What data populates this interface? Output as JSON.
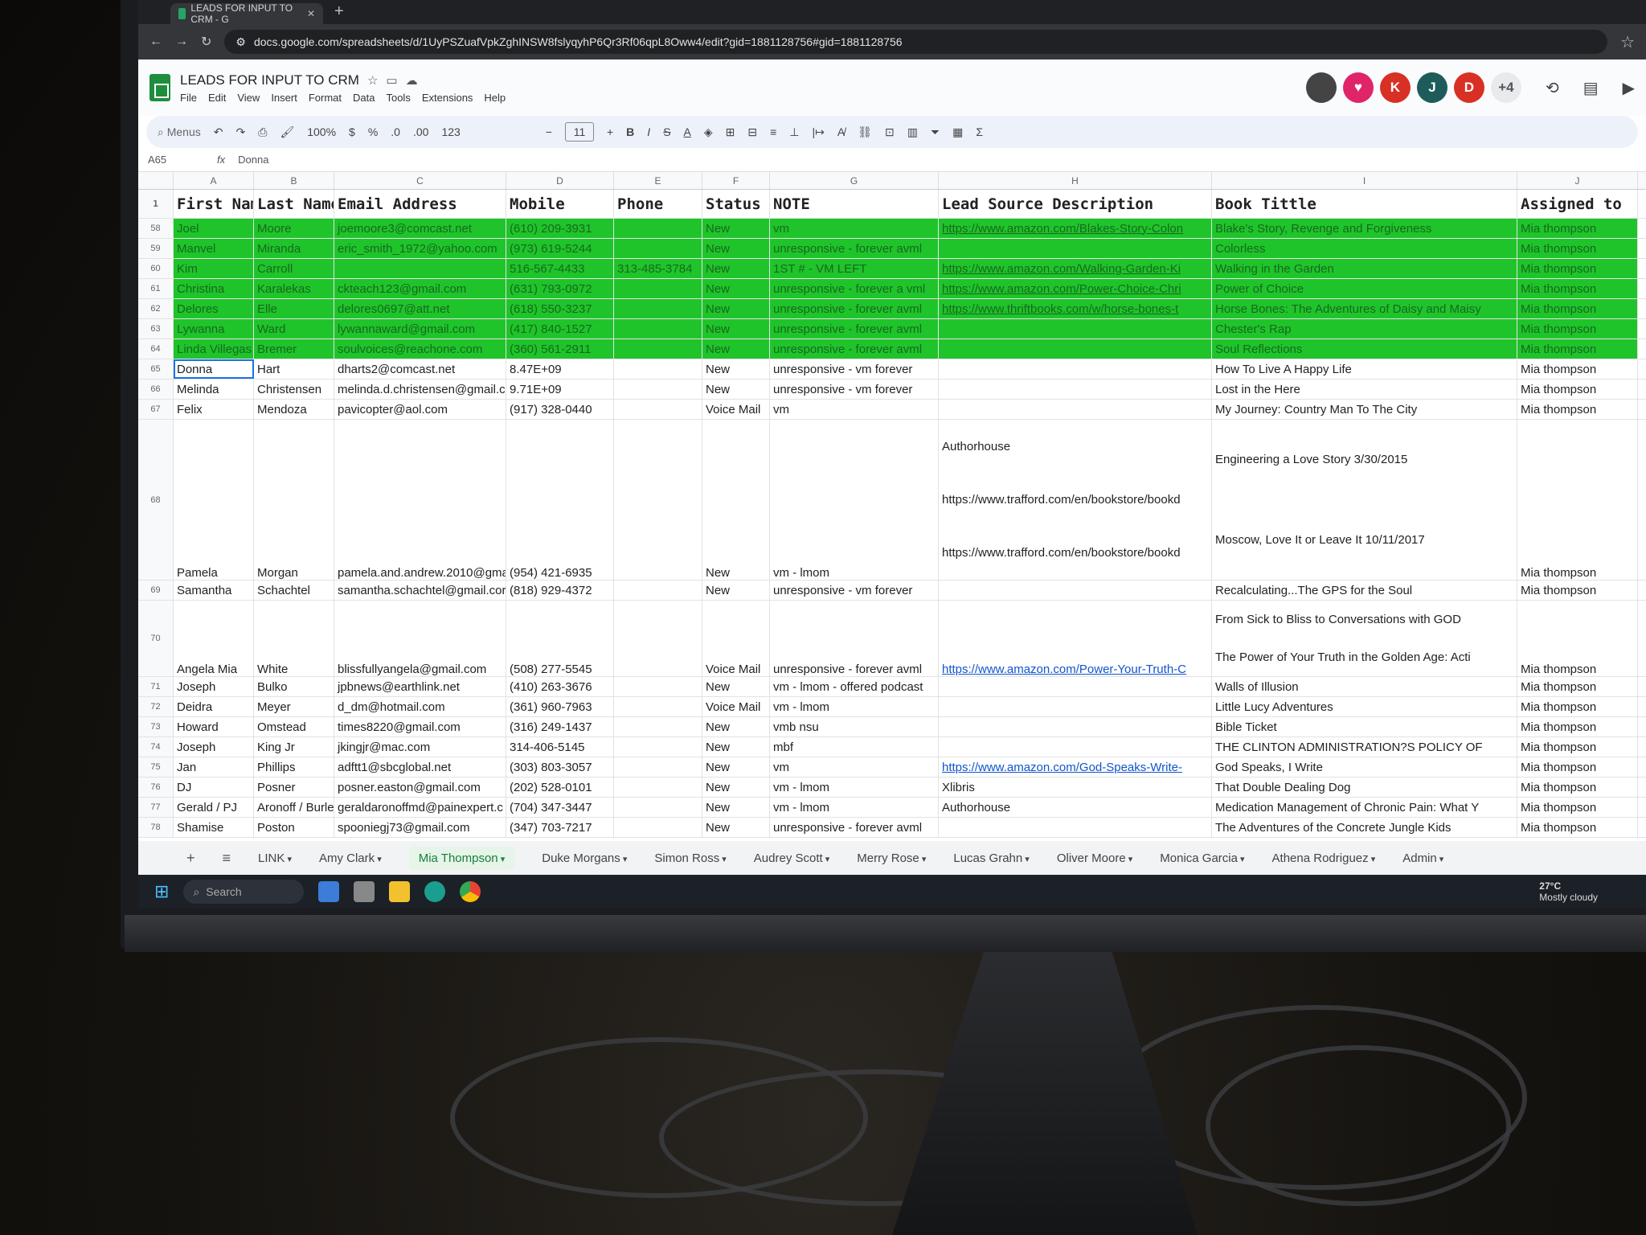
{
  "browser": {
    "tab_title": "LEADS FOR INPUT TO CRM - G",
    "new_tab": "+",
    "url": "docs.google.com/spreadsheets/d/1UyPSZuafVpkZghINSW8fslyqyhP6Qr3Rf06qpL8Oww4/edit?gid=1881128756#gid=1881128756"
  },
  "doc": {
    "title": "LEADS FOR INPUT TO CRM",
    "menu": [
      "File",
      "Edit",
      "View",
      "Insert",
      "Format",
      "Data",
      "Tools",
      "Extensions",
      "Help"
    ]
  },
  "collaborators": [
    {
      "label": "",
      "color": "#444444"
    },
    {
      "label": "♥",
      "color": "#e0246a"
    },
    {
      "label": "K",
      "color": "#d93025"
    },
    {
      "label": "J",
      "color": "#1e5c5c"
    },
    {
      "label": "D",
      "color": "#d93025"
    },
    {
      "label": "+4",
      "color": "#e8eaed"
    }
  ],
  "toolbar": {
    "search": "Menus",
    "zoom": "100%",
    "currency": "$",
    "percent": "%",
    "dec_less": ".0",
    "dec_more": ".00",
    "format": "123",
    "font_size": "11",
    "bold": "B",
    "italic": "I",
    "sum": "Σ"
  },
  "formula_bar": {
    "cell": "A65",
    "fx": "fx",
    "value": "Donna"
  },
  "columns": [
    "A",
    "B",
    "C",
    "D",
    "E",
    "F",
    "G",
    "H",
    "I",
    "J"
  ],
  "header_row": {
    "num": "1",
    "cells": [
      "First Nam",
      "Last Name",
      "Email Address",
      "Mobile",
      "Phone",
      "Status",
      "NOTE",
      "Lead Source Description",
      "Book Tittle",
      "Assigned to"
    ]
  },
  "rows": [
    {
      "num": "58",
      "green": true,
      "cells": [
        "Joel",
        "Moore",
        "joemoore3@comcast.net",
        "(610) 209-3931",
        "",
        "New",
        "vm",
        "https://www.amazon.com/Blakes-Story-Colon",
        "Blake's Story, Revenge and Forgiveness",
        "Mia thompson"
      ]
    },
    {
      "num": "59",
      "green": true,
      "cells": [
        "Manvel",
        "Miranda",
        "eric_smith_1972@yahoo.com",
        "(973) 619-5244",
        "",
        "New",
        "unresponsive - forever avml",
        "",
        "Colorless",
        "Mia thompson"
      ]
    },
    {
      "num": "60",
      "green": true,
      "cells": [
        "Kim",
        "Carroll",
        "",
        "516-567-4433",
        "313-485-3784",
        "New",
        "1ST # - VM LEFT",
        "https://www.amazon.com/Walking-Garden-Ki",
        "Walking in the Garden",
        "Mia thompson"
      ]
    },
    {
      "num": "61",
      "green": true,
      "cells": [
        "Christina",
        "Karalekas",
        "ckteach123@gmail.com",
        "(631) 793-0972",
        "",
        "New",
        "unresponsive - forever a vml",
        "https://www.amazon.com/Power-Choice-Chri",
        "Power of Choice",
        "Mia thompson"
      ]
    },
    {
      "num": "62",
      "green": true,
      "cells": [
        "Delores",
        "Elle",
        "delores0697@att.net",
        "(618) 550-3237",
        "",
        "New",
        "unresponsive - forever avml",
        "https://www.thriftbooks.com/w/horse-bones-t",
        "Horse Bones: The Adventures of Daisy and Maisy",
        "Mia thompson"
      ]
    },
    {
      "num": "63",
      "green": true,
      "cells": [
        "Lywanna",
        "Ward",
        "lywannaward@gmail.com",
        "(417) 840-1527",
        "",
        "New",
        "unresponsive - forever avml",
        "",
        "Chester's Rap",
        "Mia thompson"
      ]
    },
    {
      "num": "64",
      "green": true,
      "cells": [
        "Linda Villegas",
        "Bremer",
        "soulvoices@reachone.com",
        "(360) 561-2911",
        "",
        "New",
        "unresponsive - forever avml",
        "",
        "Soul Reflections",
        "Mia thompson"
      ]
    },
    {
      "num": "65",
      "green": false,
      "selected": true,
      "cells": [
        "Donna",
        "Hart",
        "dharts2@comcast.net",
        "8.47E+09",
        "",
        "New",
        "unresponsive - vm forever",
        "",
        "How To Live A Happy Life",
        "Mia thompson"
      ]
    },
    {
      "num": "66",
      "green": false,
      "cells": [
        "Melinda",
        "Christensen",
        "melinda.d.christensen@gmail.c",
        "9.71E+09",
        "",
        "New",
        "unresponsive - vm forever",
        "",
        "Lost in the Here",
        "Mia thompson"
      ]
    },
    {
      "num": "67",
      "green": false,
      "cells": [
        "Felix",
        "Mendoza",
        "pavicopter@aol.com",
        "(917) 328-0440",
        "",
        "Voice Mail",
        "vm",
        "",
        "My Journey: Country Man To The City",
        "Mia thompson"
      ]
    },
    {
      "num": "68",
      "green": false,
      "tall": true,
      "cells": [
        "Pamela",
        "Morgan",
        "pamela.and.andrew.2010@gma",
        "(954) 421-6935",
        "",
        "New",
        "vm - lmom",
        "Authorhouse|https://www.trafford.com/en/bookstore/bookd|https://www.trafford.com/en/bookstore/bookd",
        "Engineering a Love Story 3/30/2015|Moscow, Love It or Leave It 10/11/2017",
        "Mia thompson"
      ]
    },
    {
      "num": "69",
      "green": false,
      "cells": [
        "Samantha",
        "Schachtel",
        "samantha.schachtel@gmail.cor",
        "(818) 929-4372",
        "",
        "New",
        "unresponsive - vm forever",
        "",
        "Recalculating...The GPS for the Soul",
        "Mia thompson"
      ]
    },
    {
      "num": "70",
      "green": false,
      "tall2": true,
      "cells": [
        "Angela Mia",
        "White",
        "blissfullyangela@gmail.com",
        "(508) 277-5545",
        "",
        "Voice Mail",
        "unresponsive - forever avml",
        "https://www.amazon.com/Power-Your-Truth-C",
        "From Sick to Bliss to Conversations with GOD|The Power of Your Truth in the Golden Age: Acti",
        "Mia thompson"
      ]
    },
    {
      "num": "71",
      "green": false,
      "cells": [
        "Joseph",
        "Bulko",
        "jpbnews@earthlink.net",
        "(410) 263-3676",
        "",
        "New",
        "vm - lmom - offered podcast",
        "",
        "Walls of Illusion",
        "Mia thompson"
      ]
    },
    {
      "num": "72",
      "green": false,
      "cells": [
        "Deidra",
        "Meyer",
        "d_dm@hotmail.com",
        "(361) 960-7963",
        "",
        "Voice Mail",
        "vm - lmom",
        "",
        "Little Lucy Adventures",
        "Mia thompson"
      ]
    },
    {
      "num": "73",
      "green": false,
      "cells": [
        "Howard",
        "Omstead",
        "times8220@gmail.com",
        "(316) 249-1437",
        "",
        "New",
        "vmb nsu",
        "",
        "Bible Ticket",
        "Mia thompson"
      ]
    },
    {
      "num": "74",
      "green": false,
      "cells": [
        "Joseph",
        "King Jr",
        "jkingjr@mac.com",
        "314-406-5145",
        "",
        "New",
        "mbf",
        "",
        "THE CLINTON ADMINISTRATION?S POLICY OF",
        "Mia thompson"
      ]
    },
    {
      "num": "75",
      "green": false,
      "cells": [
        "Jan",
        "Phillips",
        "adftt1@sbcglobal.net",
        "(303) 803-3057",
        "",
        "New",
        "vm",
        "https://www.amazon.com/God-Speaks-Write-",
        "God Speaks, I Write",
        "Mia thompson"
      ]
    },
    {
      "num": "76",
      "green": false,
      "cells": [
        "DJ",
        "Posner",
        "posner.easton@gmail.com",
        "(202) 528-0101",
        "",
        "New",
        "vm - lmom",
        "Xlibris",
        "That Double Dealing Dog",
        "Mia thompson"
      ]
    },
    {
      "num": "77",
      "green": false,
      "cells": [
        "Gerald / PJ",
        "Aronoff / Burles",
        "geraldaronoffmd@painexpert.c",
        "(704) 347-3447",
        "",
        "New",
        "vm - lmom",
        "Authorhouse",
        "Medication Management of Chronic Pain: What Y",
        "Mia thompson"
      ]
    },
    {
      "num": "78",
      "green": false,
      "cells": [
        "Shamise",
        "Poston",
        "spooniegj73@gmail.com",
        "(347) 703-7217",
        "",
        "New",
        "unresponsive - forever avml",
        "",
        "The Adventures of the Concrete Jungle Kids",
        "Mia thompson"
      ]
    }
  ],
  "sheet_tabs": [
    "LINK",
    "Amy Clark",
    "Mia Thompson",
    "Duke Morgans",
    "Simon Ross",
    "Audrey Scott",
    "Merry Rose",
    "Lucas Grahn",
    "Oliver Moore",
    "Monica Garcia",
    "Athena Rodriguez",
    "Admin"
  ],
  "active_sheet": "Mia Thompson",
  "taskbar": {
    "search": "Search",
    "temp": "27°C",
    "weather": "Mostly cloudy"
  },
  "colors": {
    "green_highlight": "#1fc42b",
    "sheets_green": "#1e8e3e",
    "link": "#1155cc"
  }
}
